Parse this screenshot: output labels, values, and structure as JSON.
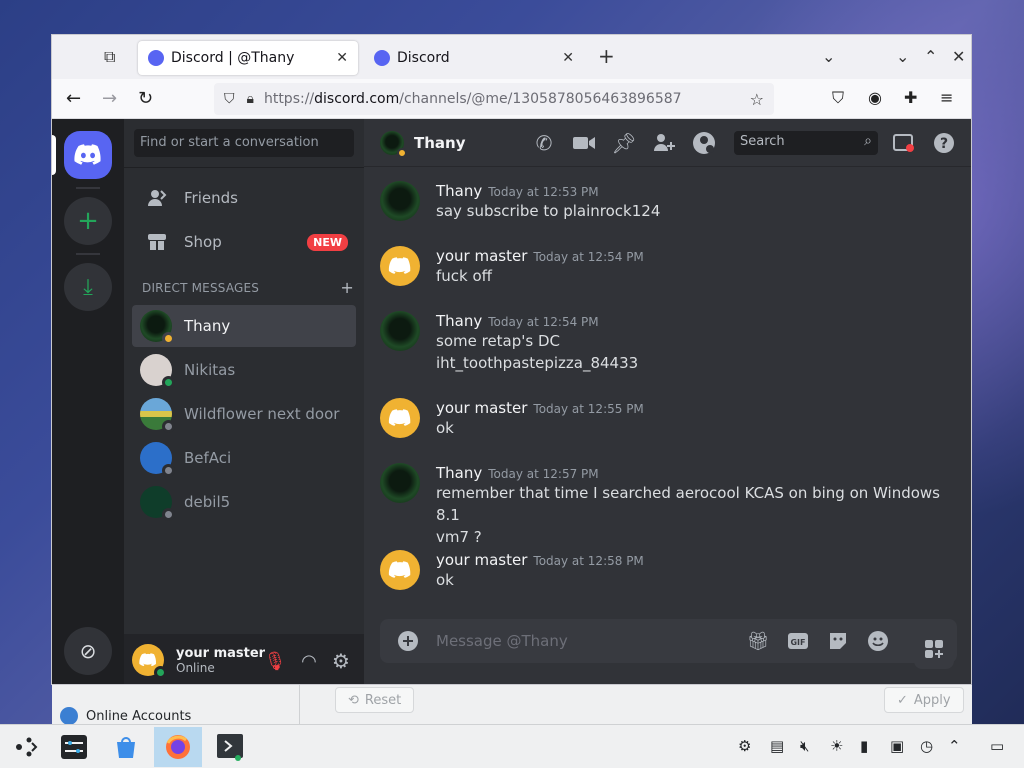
{
  "browser": {
    "tabs": [
      {
        "label": "Discord | @Thany",
        "active": true
      },
      {
        "label": "Discord",
        "active": false
      }
    ],
    "url_prefix": "https://",
    "url_host": "discord.com",
    "url_path": "/channels/@me/1305878056463896587"
  },
  "sidebar": {
    "search_placeholder": "Find or start a conversation",
    "friends_label": "Friends",
    "shop_label": "Shop",
    "shop_badge": "NEW",
    "dm_header": "DIRECT MESSAGES",
    "dms": [
      {
        "name": "Thany",
        "status": "idle",
        "active": true,
        "avatar_color": "#123318"
      },
      {
        "name": "Nikitas",
        "status": "online",
        "active": false,
        "avatar_color": "#d9d2cf"
      },
      {
        "name": "Wildflower next door",
        "status": "offline",
        "active": false,
        "avatar_color": "#6aa7d8"
      },
      {
        "name": "BefAci",
        "status": "offline",
        "active": false,
        "avatar_color": "#2c6fc9"
      },
      {
        "name": "debil5",
        "status": "offline",
        "active": false,
        "avatar_color": "#0f3d2a"
      }
    ]
  },
  "user_panel": {
    "name": "your master",
    "status": "Online"
  },
  "chat": {
    "recipient": "Thany",
    "search_placeholder": "Search",
    "composer_placeholder": "Message @Thany",
    "messages": [
      {
        "author": "Thany",
        "time": "Today at 12:53 PM",
        "lines": [
          "say subscribe to plainrock124"
        ],
        "avatar": "thany"
      },
      {
        "author": "your master",
        "time": "Today at 12:54 PM",
        "lines": [
          "fuck off"
        ],
        "avatar": "master"
      },
      {
        "author": "Thany",
        "time": "Today at 12:54 PM",
        "lines": [
          "some retap's DC",
          "iht_toothpastepizza_84433"
        ],
        "avatar": "thany"
      },
      {
        "author": "your master",
        "time": "Today at 12:55 PM",
        "lines": [
          "ok"
        ],
        "avatar": "master"
      },
      {
        "author": "Thany",
        "time": "Today at 12:57 PM",
        "lines": [
          "remember that time I searched aerocool KCAS on bing on Windows 8.1",
          "vm7 ?"
        ],
        "avatar": "thany"
      },
      {
        "author": "your master",
        "time": "Today at 12:58 PM",
        "lines": [
          "ok"
        ],
        "avatar": "master"
      }
    ]
  },
  "background_window": {
    "item_label": "Online Accounts",
    "reset_label": "Reset",
    "apply_label": "Apply"
  },
  "colors": {
    "discord_blurple": "#5865f2",
    "online": "#23a55a",
    "idle": "#f0b232",
    "offline": "#80848e",
    "danger": "#f23f43"
  }
}
